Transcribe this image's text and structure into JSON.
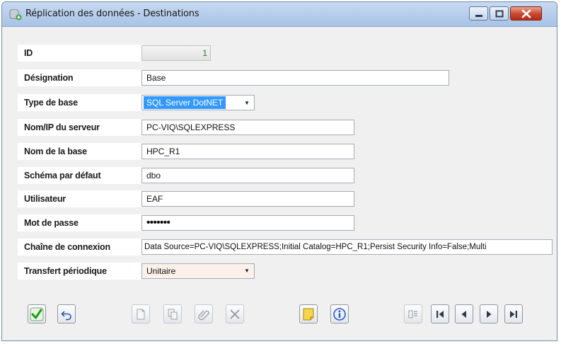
{
  "window": {
    "title": "Réplication des données - Destinations"
  },
  "form": {
    "id": {
      "label": "ID",
      "value": "1"
    },
    "designation": {
      "label": "Désignation",
      "value": "Base"
    },
    "type_base": {
      "label": "Type de base",
      "value": "SQL Server DotNET"
    },
    "serveur": {
      "label": "Nom/IP du serveur",
      "value": "PC-VIQ\\SQLEXPRESS"
    },
    "nom_base": {
      "label": "Nom de la base",
      "value": "HPC_R1"
    },
    "schema": {
      "label": "Schéma par défaut",
      "value": "dbo"
    },
    "utilisateur": {
      "label": "Utilisateur",
      "value": "EAF"
    },
    "mot_de_passe": {
      "label": "Mot de passe",
      "value": "•••••••"
    },
    "chaine": {
      "label": "Chaîne de connexion",
      "value": "Data Source=PC-VIQ\\SQLEXPRESS;Initial Catalog=HPC_R1;Persist Security Info=False;Multi"
    },
    "transfert": {
      "label": "Transfert périodique",
      "value": "Unitaire"
    }
  },
  "toolbar": {
    "icons": [
      "check-icon",
      "undo-icon",
      "new-document-icon",
      "copy-icon",
      "attach-icon",
      "delete-icon",
      "note-icon",
      "info-icon",
      "list-icon",
      "first-record-icon",
      "previous-record-icon",
      "next-record-icon",
      "last-record-icon"
    ]
  },
  "colors": {
    "title_bar": "#b9cfec",
    "label_bg": "#ffffff",
    "selection": "#3399ff",
    "close_button": "#c9462c"
  }
}
